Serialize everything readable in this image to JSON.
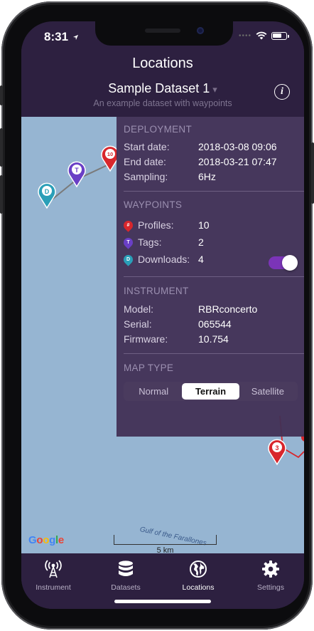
{
  "status": {
    "time": "8:31"
  },
  "header": {
    "title": "Locations",
    "dataset_name": "Sample Dataset 1",
    "dataset_caret": "▾",
    "subtitle": "An example dataset with waypoints",
    "info_glyph": "i"
  },
  "map": {
    "markers": [
      {
        "letter": "D",
        "color": "#2a9fb8"
      },
      {
        "letter": "T",
        "color": "#6a3fc6"
      },
      {
        "letter": "10",
        "color": "#d8262c"
      },
      {
        "letter": "3",
        "color": "#d8262c"
      }
    ],
    "gulf_label": "Gulf of the Farallones",
    "scale_label": "5 km",
    "google_logo": [
      "G",
      "o",
      "o",
      "g",
      "l",
      "e"
    ],
    "google_colors": [
      "#4285f4",
      "#ea4335",
      "#fbbc05",
      "#4285f4",
      "#34a853",
      "#ea4335"
    ]
  },
  "panel": {
    "deployment": {
      "title": "DEPLOYMENT",
      "rows": [
        {
          "label": "Start date:",
          "value": "2018-03-08 09:06"
        },
        {
          "label": "End date:",
          "value": "2018-03-21 07:47"
        },
        {
          "label": "Sampling:",
          "value": "6Hz"
        }
      ]
    },
    "waypoints": {
      "title": "WAYPOINTS",
      "rows": [
        {
          "label": "Profiles:",
          "value": "10",
          "icon": "#",
          "color": "#d8262c"
        },
        {
          "label": "Tags:",
          "value": "2",
          "icon": "T",
          "color": "#6a3fc6"
        },
        {
          "label": "Downloads:",
          "value": "4",
          "icon": "D",
          "color": "#2a9fb8"
        }
      ],
      "downloads_toggle_on": true
    },
    "instrument": {
      "title": "INSTRUMENT",
      "rows": [
        {
          "label": "Model:",
          "value": "RBRconcerto"
        },
        {
          "label": "Serial:",
          "value": "065544"
        },
        {
          "label": "Firmware:",
          "value": "10.754"
        }
      ]
    },
    "map_type": {
      "title": "MAP TYPE",
      "options": [
        "Normal",
        "Terrain",
        "Satellite"
      ],
      "selected": "Terrain"
    }
  },
  "tabbar": {
    "tabs": [
      {
        "label": "Instrument",
        "icon": "antenna-icon"
      },
      {
        "label": "Datasets",
        "icon": "database-icon"
      },
      {
        "label": "Locations",
        "icon": "globe-icon"
      },
      {
        "label": "Settings",
        "icon": "gear-icon"
      }
    ],
    "active": "Locations"
  },
  "colors": {
    "header_bg": "#2d2040",
    "map_water": "#96b5d2",
    "panel_bg": "#413055",
    "accent_toggle": "#7b34b8"
  }
}
